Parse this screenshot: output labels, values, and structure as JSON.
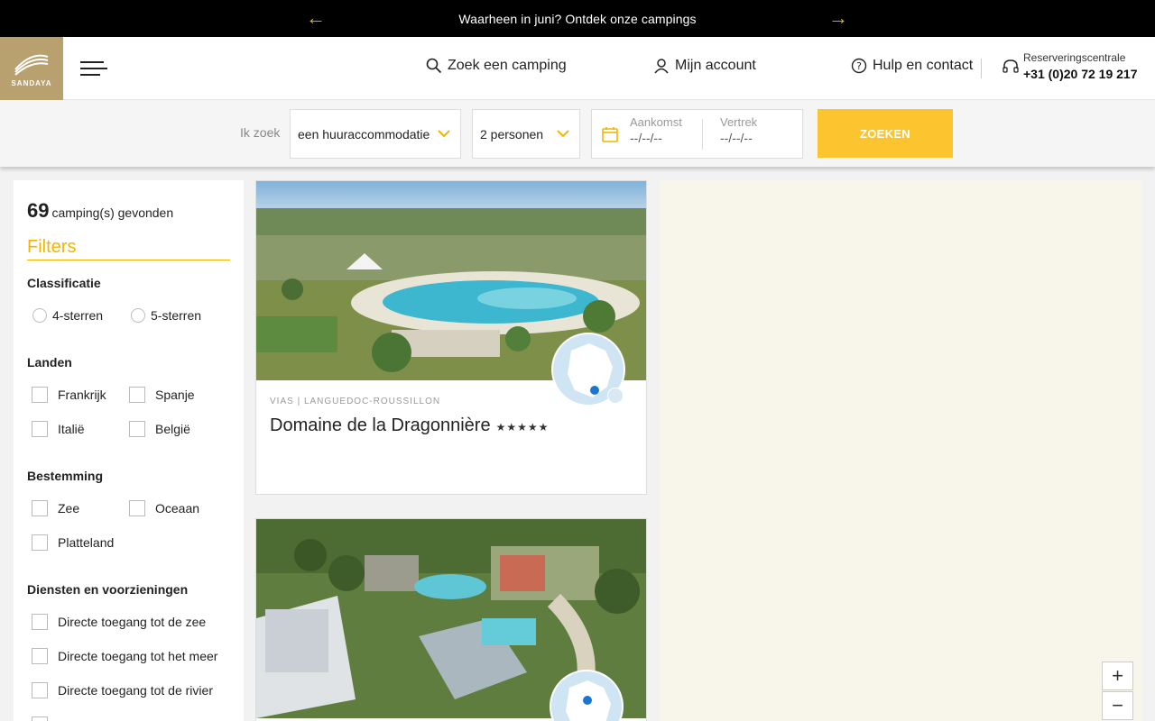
{
  "promo": {
    "text": "Waarheen in juni? Ontdek onze campings"
  },
  "header": {
    "logo_text": "SANDAYA",
    "nav": {
      "search": "Zoek een camping",
      "account": "Mijn account",
      "help": "Hulp en contact"
    },
    "reservation": {
      "label": "Reserveringscentrale",
      "phone": "+31 (0)20 72 19 217"
    }
  },
  "searchbar": {
    "label": "Ik zoek",
    "type_value": "een huuraccommodatie",
    "persons_value": "2 personen",
    "arrival_label": "Aankomst",
    "arrival_value": "--/--/--",
    "departure_label": "Vertrek",
    "departure_value": "--/--/--",
    "submit": "ZOEKEN"
  },
  "filters": {
    "count": "69",
    "count_label": "camping(s) gevonden",
    "title": "Filters",
    "classification": {
      "title": "Classificatie",
      "options": [
        "4-sterren",
        "5-sterren"
      ]
    },
    "countries": {
      "title": "Landen",
      "options": [
        "Frankrijk",
        "Spanje",
        "Italië",
        "België"
      ]
    },
    "destination": {
      "title": "Bestemming",
      "options": [
        "Zee",
        "Oceaan",
        "Platteland"
      ]
    },
    "services": {
      "title": "Diensten en voorzieningen",
      "options": [
        "Directe toegang tot de zee",
        "Directe toegang tot het meer",
        "Directe toegang tot de rivier"
      ]
    }
  },
  "cards": [
    {
      "location": "VIAS | LANGUEDOC-ROUSSILLON",
      "name": "Domaine de la Dragonnière",
      "stars": "★★★★★"
    }
  ],
  "map": {
    "zoom_in": "+",
    "zoom_out": "−"
  },
  "colors": {
    "accent": "#fcc42e",
    "brand": "#b8a16f",
    "title": "#f4b400"
  }
}
